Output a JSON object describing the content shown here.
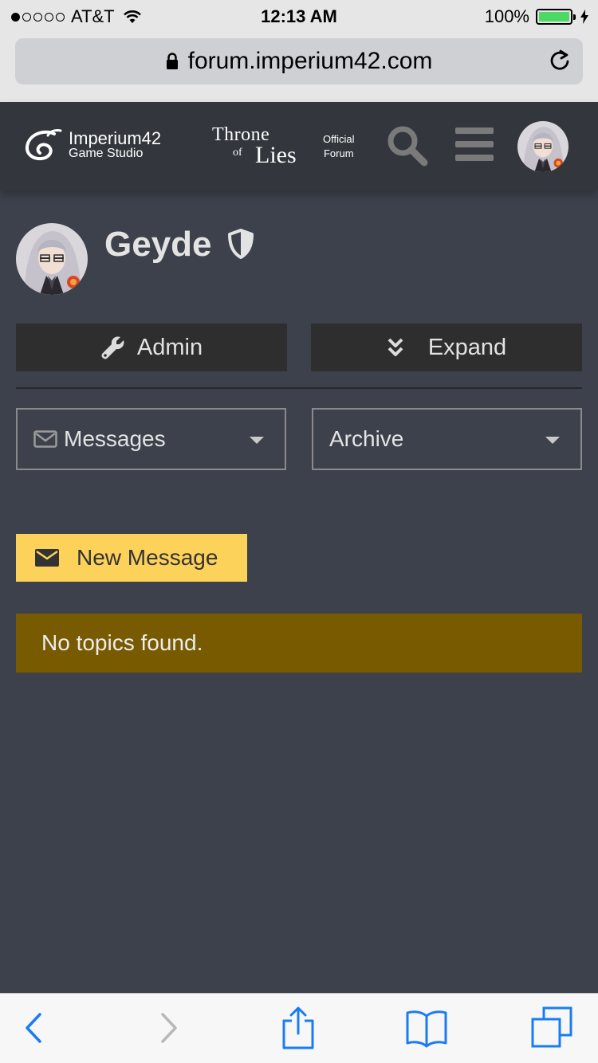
{
  "status_bar": {
    "carrier": "AT&T",
    "time": "12:13 AM",
    "battery": "100%",
    "battery_level": 1.0,
    "signal_bars": 1
  },
  "url_bar": {
    "url": "forum.imperium42.com"
  },
  "header": {
    "studio_name": "Imperium42",
    "studio_sub": "Game Studio",
    "game_title_line1": "Throne",
    "game_title_of": "of",
    "game_title_line2": "Lies",
    "official_line1": "Official",
    "official_line2": "Forum"
  },
  "profile": {
    "username": "Geyde"
  },
  "buttons": {
    "admin": "Admin",
    "expand": "Expand",
    "new_message": "New Message"
  },
  "selects": {
    "messages": "Messages",
    "archive": "Archive"
  },
  "alert": {
    "text": "No topics found."
  },
  "colors": {
    "page_bg": "#3d414b",
    "header_bg": "#33363c",
    "button_bg": "#2e2e2e",
    "new_message_bg": "#fdd25b",
    "alert_bg": "#785a00",
    "ios_blue": "#1a7cf5"
  }
}
